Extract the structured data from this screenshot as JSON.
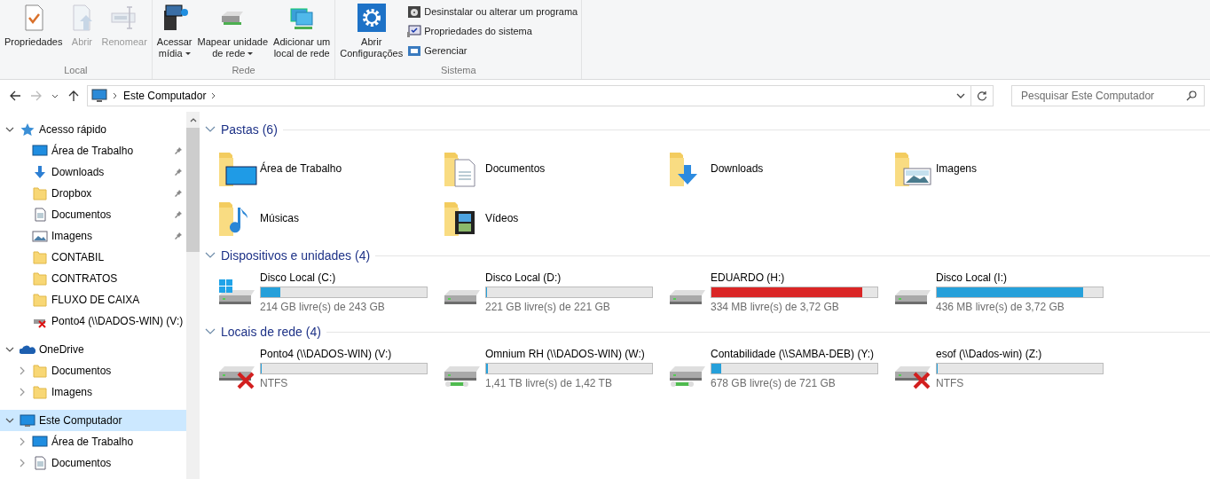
{
  "ribbon": {
    "groups": [
      {
        "label": "Local",
        "buttons": [
          {
            "kind": "properties",
            "lines": [
              "Propriedades"
            ],
            "disabled": false,
            "dropdown": false
          },
          {
            "kind": "open",
            "lines": [
              "Abrir"
            ],
            "disabled": true,
            "dropdown": false
          },
          {
            "kind": "rename",
            "lines": [
              "Renomear"
            ],
            "disabled": true,
            "dropdown": false
          }
        ]
      },
      {
        "label": "Rede",
        "buttons": [
          {
            "kind": "media",
            "lines": [
              "Acessar",
              "mídia"
            ],
            "disabled": false,
            "dropdown": true
          },
          {
            "kind": "map",
            "lines": [
              "Mapear unidade",
              "de rede"
            ],
            "disabled": false,
            "dropdown": true
          },
          {
            "kind": "add",
            "lines": [
              "Adicionar um",
              "local de rede"
            ],
            "disabled": false,
            "dropdown": false
          }
        ]
      },
      {
        "label": "Sistema",
        "buttons": [
          {
            "kind": "settings",
            "lines": [
              "Abrir",
              "Configurações"
            ],
            "disabled": false,
            "dropdown": false
          }
        ],
        "small": [
          {
            "kind": "uninstall",
            "label": "Desinstalar ou alterar um programa"
          },
          {
            "kind": "system",
            "label": "Propriedades do sistema"
          },
          {
            "kind": "manage",
            "label": "Gerenciar"
          }
        ]
      }
    ]
  },
  "nav": {
    "back_disabled": false,
    "forward_disabled": true,
    "breadcrumb": "Este Computador",
    "search": {
      "placeholder": "Pesquisar Este Computador"
    }
  },
  "sidebar": {
    "items": [
      {
        "kind": "star",
        "label": "Acesso rápido",
        "expanded": true,
        "selected": false,
        "children": [
          {
            "kind": "desktop",
            "label": "Área de Trabalho",
            "pinned": true,
            "selected": false
          },
          {
            "kind": "download",
            "label": "Downloads",
            "pinned": true,
            "selected": false
          },
          {
            "kind": "folder",
            "label": "Dropbox",
            "pinned": true,
            "selected": false
          },
          {
            "kind": "documents",
            "label": "Documentos",
            "pinned": true,
            "selected": false
          },
          {
            "kind": "pictures",
            "label": "Imagens",
            "pinned": true,
            "selected": false
          },
          {
            "kind": "folder",
            "label": "CONTABIL",
            "pinned": false,
            "selected": false
          },
          {
            "kind": "folder",
            "label": "CONTRATOS",
            "pinned": false,
            "selected": false
          },
          {
            "kind": "folder",
            "label": "FLUXO DE CAIXA",
            "pinned": false,
            "selected": false
          },
          {
            "kind": "netoff",
            "label": "Ponto4 (\\\\DADOS-WIN) (V:)",
            "pinned": false,
            "selected": false
          }
        ]
      },
      {
        "kind": "cloud",
        "label": "OneDrive",
        "expanded": true,
        "selected": false,
        "children": [
          {
            "kind": "folder",
            "label": "Documentos",
            "expanded": false,
            "selected": false
          },
          {
            "kind": "folder",
            "label": "Imagens",
            "expanded": false,
            "selected": false
          }
        ]
      },
      {
        "kind": "computer",
        "label": "Este Computador",
        "expanded": true,
        "selected": true,
        "children": [
          {
            "kind": "desktop",
            "label": "Área de Trabalho",
            "expanded": false,
            "selected": false
          },
          {
            "kind": "documents",
            "label": "Documentos",
            "expanded": false,
            "selected": false
          }
        ]
      }
    ]
  },
  "sections": [
    {
      "kind": "folders",
      "title": "Pastas (6)",
      "expanded": true,
      "items": [
        {
          "kind": "desktop",
          "label": "Área de Trabalho"
        },
        {
          "kind": "documents",
          "label": "Documentos"
        },
        {
          "kind": "download",
          "label": "Downloads"
        },
        {
          "kind": "pictures",
          "label": "Imagens"
        },
        {
          "kind": "music",
          "label": "Músicas"
        },
        {
          "kind": "videos",
          "label": "Vídeos"
        }
      ]
    },
    {
      "kind": "drives",
      "title": "Dispositivos e unidades (4)",
      "expanded": true,
      "items": [
        {
          "kind": "windows",
          "label": "Disco Local (C:)",
          "level": 0.12,
          "low_space": false,
          "info": "214 GB livre(s) de 243 GB"
        },
        {
          "kind": "drive",
          "label": "Disco Local (D:)",
          "level": 0,
          "low_space": false,
          "info": "221 GB livre(s) de 221 GB"
        },
        {
          "kind": "drive",
          "label": "EDUARDO (H:)",
          "level": 0.91,
          "low_space": true,
          "info": "334 MB livre(s) de 3,72 GB"
        },
        {
          "kind": "drive",
          "label": "Disco Local (I:)",
          "level": 0.88,
          "low_space": false,
          "info": "436 MB livre(s) de 3,72 GB"
        }
      ]
    },
    {
      "kind": "drives",
      "title": "Locais de rede (4)",
      "expanded": true,
      "items": [
        {
          "kind": "netoff",
          "label": "Ponto4 (\\\\DADOS-WIN) (V:)",
          "level": 0,
          "low_space": false,
          "info": "NTFS"
        },
        {
          "kind": "net",
          "label": "Omnium RH (\\\\DADOS-WIN) (W:)",
          "level": 0.01,
          "low_space": false,
          "info": "1,41 TB livre(s) de 1,42 TB"
        },
        {
          "kind": "net",
          "label": "Contabilidade (\\\\SAMBA-DEB) (Y:)",
          "level": 0.06,
          "low_space": false,
          "info": "678 GB livre(s) de 721 GB"
        },
        {
          "kind": "netoff",
          "label": "esof (\\\\Dados-win) (Z:)",
          "level": 0,
          "low_space": false,
          "info": "NTFS"
        }
      ]
    }
  ]
}
